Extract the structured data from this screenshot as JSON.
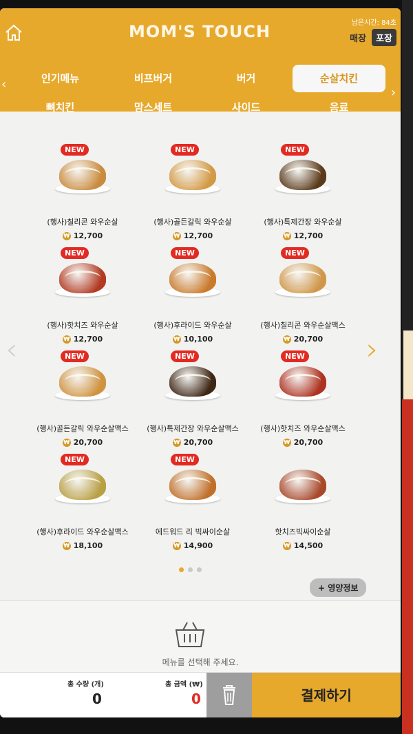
{
  "header": {
    "brand": "MOM'S TOUCH",
    "timer": "남은시간: 84초",
    "mode_dine_in": "매장",
    "mode_takeout": "포장",
    "accent": "#e7a92c"
  },
  "tabs_row1": [
    "인기메뉴",
    "비프버거",
    "버거",
    "순살치킨"
  ],
  "tabs_row2": [
    "뼈치킨",
    "맘스세트",
    "사이드",
    "음료"
  ],
  "active_tab": "순살치킨",
  "menu": [
    {
      "name": "(행사)칠리콘 와우순살",
      "price": "12,700",
      "new": "NEW",
      "color": "#c98b3d"
    },
    {
      "name": "(행사)골든갈릭 와우순살",
      "price": "12,700",
      "new": "NEW",
      "color": "#d39a45"
    },
    {
      "name": "(행사)특제간장 와우순살",
      "price": "12,700",
      "new": "NEW",
      "color": "#5a3a1a"
    },
    {
      "name": "(행사)핫치즈 와우순살",
      "price": "12,700",
      "new": "NEW",
      "color": "#b23a22"
    },
    {
      "name": "(행사)후라이드 와우순살",
      "price": "10,100",
      "new": "NEW",
      "color": "#c97a2c"
    },
    {
      "name": "(행사)칠리콘 와우순살맥스",
      "price": "20,700",
      "new": "NEW",
      "color": "#d0974a"
    },
    {
      "name": "(행사)골든갈릭 와우순살맥스",
      "price": "20,700",
      "new": "NEW",
      "color": "#cf9340"
    },
    {
      "name": "(행사)특제간장 와우순살맥스",
      "price": "20,700",
      "new": "NEW",
      "color": "#3e2614"
    },
    {
      "name": "(행사)핫치즈 와우순살맥스",
      "price": "20,700",
      "new": "NEW",
      "color": "#ae3220"
    },
    {
      "name": "(행사)후라이드 와우순살맥스",
      "price": "18,100",
      "new": "NEW",
      "color": "#b8a045"
    },
    {
      "name": "에드워드 리 빅싸이순살",
      "price": "14,900",
      "new": "NEW",
      "color": "#c0702a"
    },
    {
      "name": "핫치즈빅싸이순살",
      "price": "14,500",
      "new": "",
      "color": "#a8482a"
    }
  ],
  "currency_symbol": "₩",
  "nutrition_button": "+ 영양정보",
  "basket_message": "메뉴를 선택해 주세요.",
  "footer": {
    "qty_label": "총 수량 (개)",
    "qty_value": "0",
    "amount_label": "총 금액 (₩)",
    "amount_value": "0",
    "pay_label": "결제하기"
  }
}
